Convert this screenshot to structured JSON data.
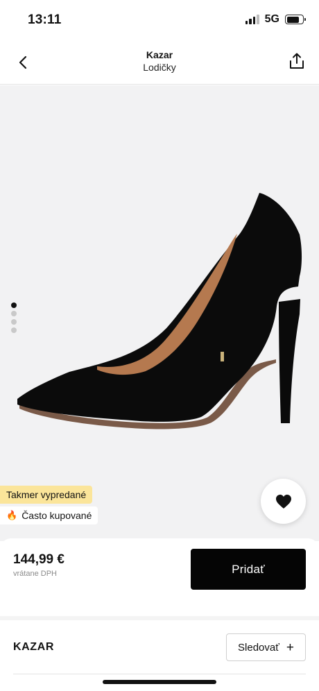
{
  "status_bar": {
    "time": "13:11",
    "network": "5G",
    "battery_level": 0.8
  },
  "header": {
    "brand": "Kazar",
    "category": "Lodičky",
    "back_icon": "chevron-left-icon",
    "share_icon": "share-icon"
  },
  "gallery": {
    "image_count": 4,
    "active_index": 0,
    "image_description_icon": "product-image",
    "background_color": "#f2f2f3"
  },
  "badges": {
    "scarce": "Takmer vypredané",
    "popular": "Často kupované",
    "popular_icon": "🔥",
    "scarce_color": "#fbe59a"
  },
  "wishlist": {
    "icon": "heart-icon"
  },
  "purchase": {
    "price": "144,99 €",
    "vat_note": "vrátane DPH",
    "add_label": "Pridať"
  },
  "brand_section": {
    "name": "KAZAR",
    "follow_label": "Sledovať",
    "follow_icon": "+"
  }
}
